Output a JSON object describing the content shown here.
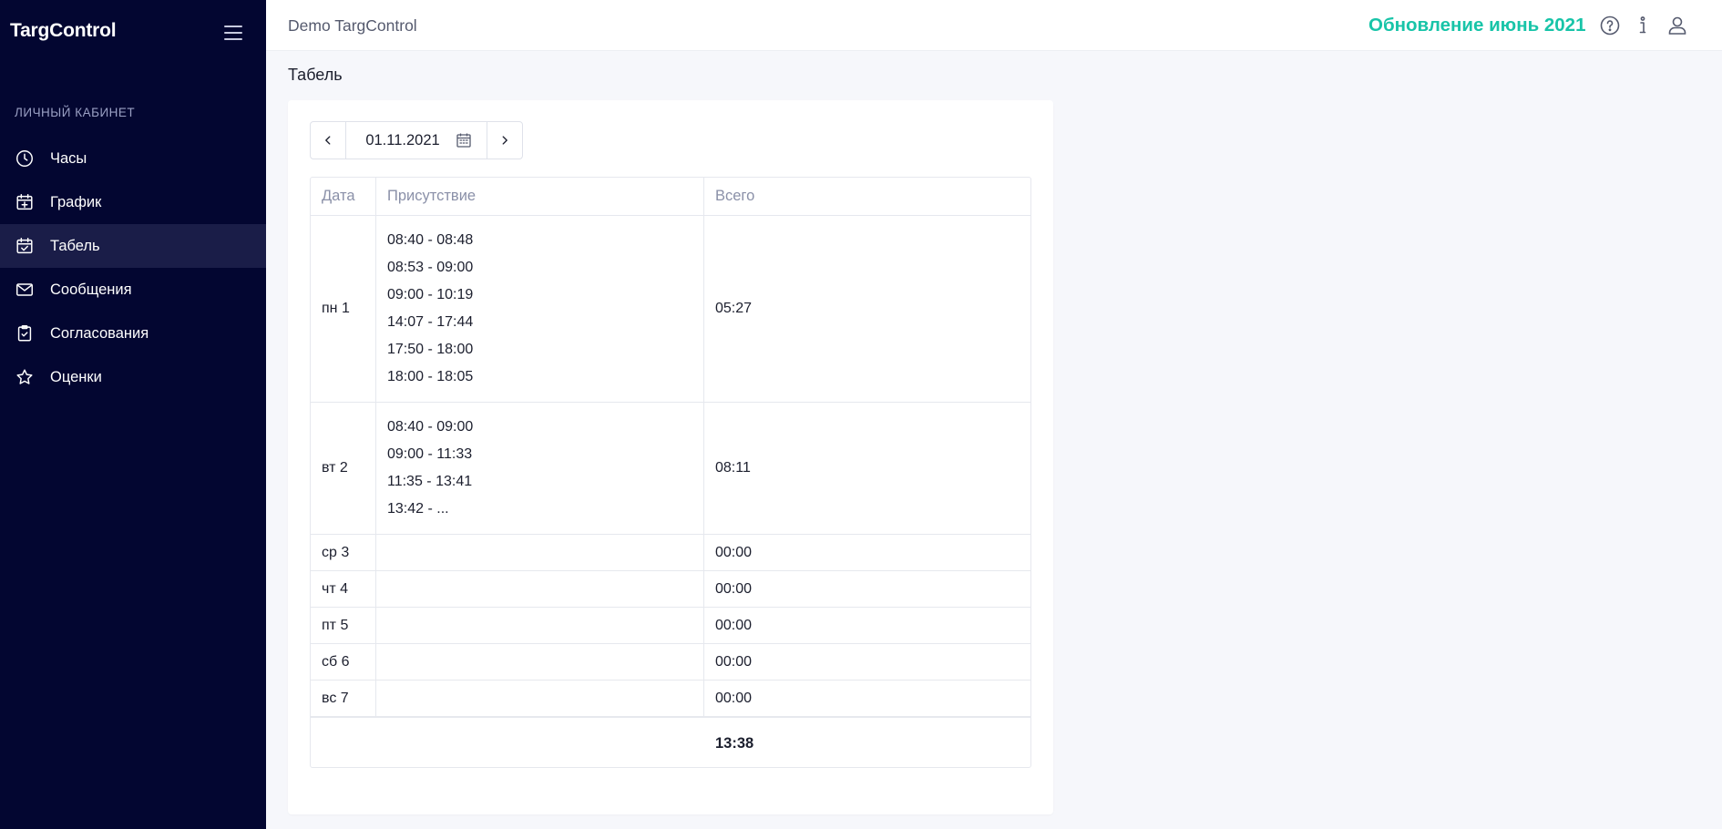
{
  "app": {
    "brand": "TargControl",
    "org": "Demo TargControl",
    "update_link": "Обновление июнь 2021"
  },
  "sidebar": {
    "section_label": "ЛИЧНЫЙ КАБИНЕТ",
    "items": [
      {
        "label": "Часы",
        "icon": "clock-icon",
        "active": false
      },
      {
        "label": "График",
        "icon": "calendar-plus-icon",
        "active": false
      },
      {
        "label": "Табель",
        "icon": "calendar-check-icon",
        "active": true
      },
      {
        "label": "Сообщения",
        "icon": "envelope-icon",
        "active": false
      },
      {
        "label": "Согласования",
        "icon": "clipboard-check-icon",
        "active": false
      },
      {
        "label": "Оценки",
        "icon": "star-icon",
        "active": false
      }
    ]
  },
  "page": {
    "title": "Табель",
    "date": "01.11.2021"
  },
  "table": {
    "headers": {
      "date": "Дата",
      "presence": "Присутствие",
      "total": "Всего"
    },
    "rows": [
      {
        "date": "пн 1",
        "presence": [
          "08:40 - 08:48",
          "08:53 - 09:00",
          "09:00 - 10:19",
          "14:07 - 17:44",
          "17:50 - 18:00",
          "18:00 - 18:05"
        ],
        "total": "05:27"
      },
      {
        "date": "вт 2",
        "presence": [
          "08:40 - 09:00",
          "09:00 - 11:33",
          "11:35 - 13:41",
          "13:42 - ..."
        ],
        "total": "08:11"
      },
      {
        "date": "ср 3",
        "presence": [],
        "total": "00:00"
      },
      {
        "date": "чт 4",
        "presence": [],
        "total": "00:00"
      },
      {
        "date": "пт 5",
        "presence": [],
        "total": "00:00"
      },
      {
        "date": "сб 6",
        "presence": [],
        "total": "00:00"
      },
      {
        "date": "вс 7",
        "presence": [],
        "total": "00:00"
      }
    ],
    "grand_total": "13:38"
  },
  "colors": {
    "sidebar_bg": "#030631",
    "sidebar_active": "#1a1d48",
    "accent": "#18c4a8",
    "page_bg": "#f6f7fb"
  }
}
